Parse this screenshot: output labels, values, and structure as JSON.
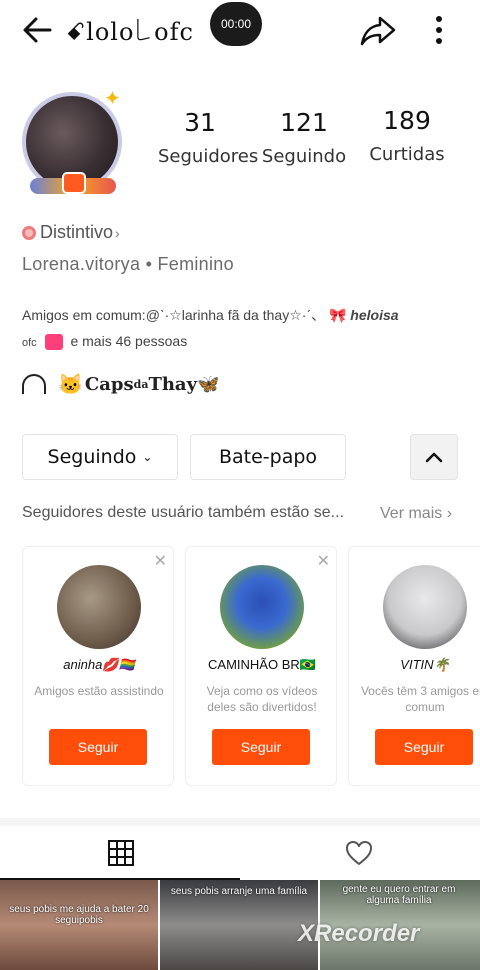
{
  "header": {
    "title": "ꗃlolo꒒ofc",
    "record_time": "00:00"
  },
  "profile": {
    "stats": [
      {
        "value": "31",
        "label": "Seguidores"
      },
      {
        "value": "121",
        "label": "Seguindo"
      },
      {
        "value": "189",
        "label": "Curtidas"
      }
    ],
    "badge_label": "Distintivo",
    "subline": "Lorena.vitorya • Feminino",
    "mutual_prefix": "Amigos em comum:",
    "mutual_friend_1": "@ˋ·☆larinha fã da thay☆·ˊ、",
    "mutual_friend_2": "heloisa",
    "mutual_friend_2b": "ofc",
    "mutual_suffix": "e mais 46 pessoas",
    "caps_text": "Caps",
    "caps_sup": "da",
    "caps_text2": "Thay"
  },
  "actions": {
    "following_label": "Seguindo",
    "chat_label": "Bate-papo"
  },
  "suggestions": {
    "title": "Seguidores deste usuário também estão se...",
    "see_more": "Ver mais",
    "cards": [
      {
        "name": "aninha💋🏳️‍🌈",
        "desc": "Amigos estão assistindo",
        "button": "Seguir"
      },
      {
        "name": "CAMINHÃO BR🇧🇷",
        "desc": "Veja como os vídeos deles são divertidos!",
        "button": "Seguir"
      },
      {
        "name": "VITIN🌴",
        "desc": "Vocês têm 3 amigos em comum",
        "button": "Seguir"
      }
    ]
  },
  "videos": [
    {
      "caption": "seus pobis me ajuda a bater 20 seguipobis"
    },
    {
      "caption": "seus pobis arranje uma família"
    },
    {
      "caption": "gente eu quero entrar em alguma família"
    }
  ],
  "watermark": "XRecorder",
  "colors": {
    "accent": "#ff4d0a",
    "stat_text": "#111111"
  }
}
